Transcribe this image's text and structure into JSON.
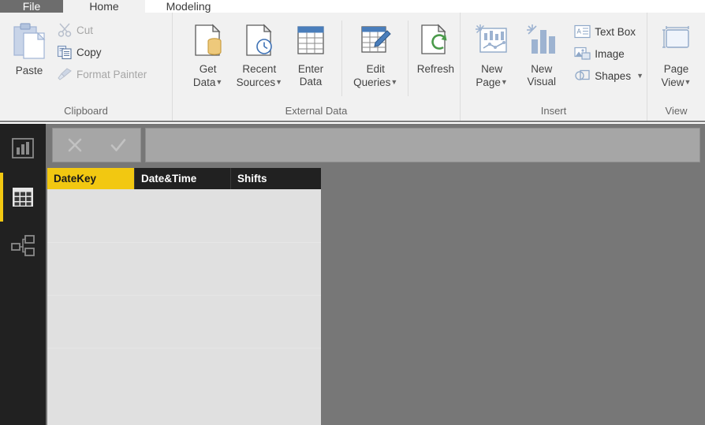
{
  "app": {
    "title": "Power BI Desktop",
    "accent_yellow": "#f2c811",
    "ribbon_bg": "#f1f1f1",
    "canvas_bg": "#777777",
    "sidebar_bg": "#212121"
  },
  "tabs": [
    {
      "label": "File",
      "state": "file"
    },
    {
      "label": "Home",
      "state": "active"
    },
    {
      "label": "Modeling",
      "state": "normal"
    }
  ],
  "ribbon": {
    "groups": [
      {
        "name": "clipboard",
        "label": "Clipboard",
        "paste": {
          "label": "Paste",
          "icon": "paste-icon"
        },
        "items": [
          {
            "label": "Cut",
            "icon": "scissors-icon",
            "disabled": true
          },
          {
            "label": "Copy",
            "icon": "copy-icon",
            "disabled": false
          },
          {
            "label": "Format Painter",
            "icon": "format-painter-icon",
            "disabled": true
          }
        ]
      },
      {
        "name": "external-data",
        "label": "External Data",
        "items": [
          {
            "label_line1": "Get",
            "label_line2": "Data",
            "icon": "get-data-icon",
            "has_caret": true
          },
          {
            "label_line1": "Recent",
            "label_line2": "Sources",
            "icon": "recent-sources-icon",
            "has_caret": true
          },
          {
            "label_line1": "Enter",
            "label_line2": "Data",
            "icon": "enter-data-icon",
            "has_caret": false
          },
          {
            "label_line1": "Edit",
            "label_line2": "Queries",
            "icon": "edit-queries-icon",
            "has_caret": true
          },
          {
            "label_line1": "Refresh",
            "label_line2": "",
            "icon": "refresh-icon",
            "has_caret": false
          }
        ]
      },
      {
        "name": "insert",
        "label": "Insert",
        "items": [
          {
            "label_line1": "New",
            "label_line2": "Page",
            "icon": "new-page-icon",
            "has_caret": true
          },
          {
            "label_line1": "New",
            "label_line2": "Visual",
            "icon": "new-visual-icon",
            "has_caret": false
          }
        ],
        "small_items": [
          {
            "label": "Text Box",
            "icon": "text-box-icon",
            "has_caret": false
          },
          {
            "label": "Image",
            "icon": "image-icon",
            "has_caret": false
          },
          {
            "label": "Shapes",
            "icon": "shapes-icon",
            "has_caret": true
          }
        ]
      },
      {
        "name": "view",
        "label": "View",
        "items": [
          {
            "label_line1": "Page",
            "label_line2": "View",
            "icon": "page-view-icon",
            "has_caret": true
          }
        ]
      }
    ]
  },
  "sidebar": {
    "items": [
      {
        "name": "report-view",
        "icon": "report-bar-chart-icon",
        "selected": false
      },
      {
        "name": "data-view",
        "icon": "data-grid-icon",
        "selected": true
      },
      {
        "name": "model-view",
        "icon": "model-relationships-icon",
        "selected": false
      }
    ]
  },
  "formula_bar": {
    "cancel": {
      "icon": "cancel-x-icon",
      "label": ""
    },
    "accept": {
      "icon": "accept-check-icon",
      "label": ""
    },
    "input_value": "",
    "input_placeholder": ""
  },
  "data_grid": {
    "columns": [
      {
        "label": "DateKey",
        "active": true,
        "width": 111
      },
      {
        "label": "Date&Time",
        "active": false,
        "width": 122
      },
      {
        "label": "Shifts",
        "active": false,
        "width": 114
      }
    ],
    "rows": []
  }
}
